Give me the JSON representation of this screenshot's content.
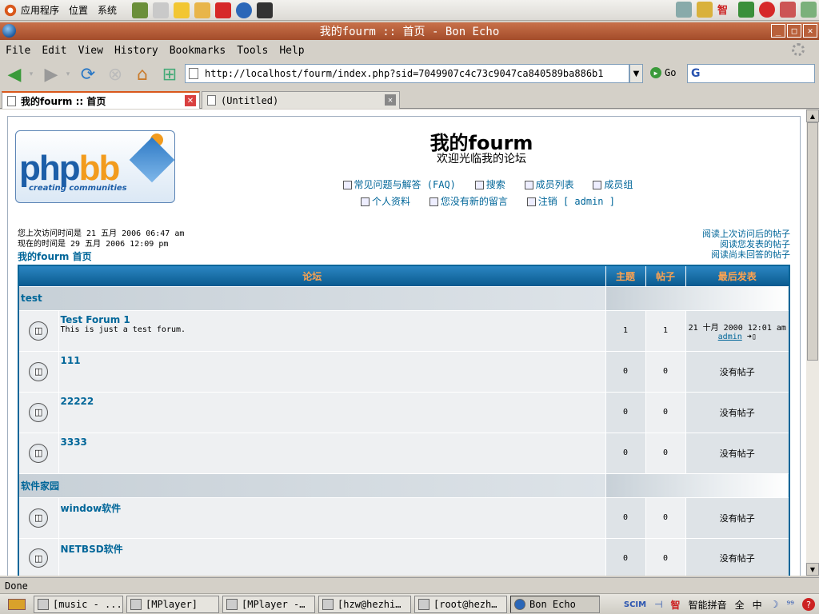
{
  "panel": {
    "menus": [
      "应用程序",
      "位置",
      "系统"
    ]
  },
  "window": {
    "title": "我的fourm :: 首页 - Bon Echo",
    "minimize": "_",
    "maximize": "□",
    "close": "✕"
  },
  "menubar": [
    "File",
    "Edit",
    "View",
    "History",
    "Bookmarks",
    "Tools",
    "Help"
  ],
  "nav": {
    "url": "http://localhost/fourm/index.php?sid=7049907c4c73c9047ca840589ba886b1",
    "go_label": "Go",
    "search_logo": "G"
  },
  "tabs": [
    {
      "label": "我的fourm :: 首页",
      "active": true
    },
    {
      "label": "(Untitled)",
      "active": false
    }
  ],
  "site": {
    "logo_text_php": "php",
    "logo_text_bb": "bb",
    "logo_tagline": "creating communities",
    "name": "我的fourm",
    "description": "欢迎光临我的论坛",
    "links_row1": [
      "常见问题与解答 (FAQ)",
      "搜索",
      "成员列表",
      "成员组"
    ],
    "links_row2": [
      "个人资料",
      "您没有新的留言",
      "注销 [ admin ]"
    ],
    "last_visit": "您上次访问时间是 21 五月 2006 06:47 am",
    "current_time": "现在的时间是 29 五月 2006 12:09 pm",
    "home_link": "我的fourm 首页",
    "right_links": [
      "阅读上次访问后的帖子",
      "阅读您发表的帖子",
      "阅读尚未回答的帖子"
    ]
  },
  "table": {
    "headers": [
      "论坛",
      "主题",
      "帖子",
      "最后发表"
    ],
    "categories": [
      {
        "name": "test",
        "forums": [
          {
            "name": "Test Forum 1",
            "desc": "This is just a test forum.",
            "topics": "1",
            "posts": "1",
            "last_date": "21 十月 2000 12:01 am",
            "last_user": "admin"
          },
          {
            "name": "111",
            "desc": "",
            "topics": "0",
            "posts": "0",
            "last_text": "没有帖子"
          },
          {
            "name": "22222",
            "desc": "",
            "topics": "0",
            "posts": "0",
            "last_text": "没有帖子"
          },
          {
            "name": "3333",
            "desc": "",
            "topics": "0",
            "posts": "0",
            "last_text": "没有帖子"
          }
        ]
      },
      {
        "name": "软件家园",
        "forums": [
          {
            "name": "window软件",
            "desc": "",
            "topics": "0",
            "posts": "0",
            "last_text": "没有帖子"
          },
          {
            "name": "NETBSD软件",
            "desc": "",
            "topics": "0",
            "posts": "0",
            "last_text": "没有帖子"
          }
        ]
      }
    ]
  },
  "status": "Done",
  "taskbar": [
    {
      "label": "[music - ..."
    },
    {
      "label": "[MPlayer]"
    },
    {
      "label": "[MPlayer -…"
    },
    {
      "label": "[hzw@hezhi…"
    },
    {
      "label": "[root@hezh…"
    },
    {
      "label": "Bon Echo",
      "active": true
    }
  ],
  "ime": [
    "智",
    "智能拼音",
    "全",
    "中"
  ],
  "colors": {
    "title_bar": "#b5603b",
    "link": "#006699",
    "header_text": "#ffa34f"
  }
}
